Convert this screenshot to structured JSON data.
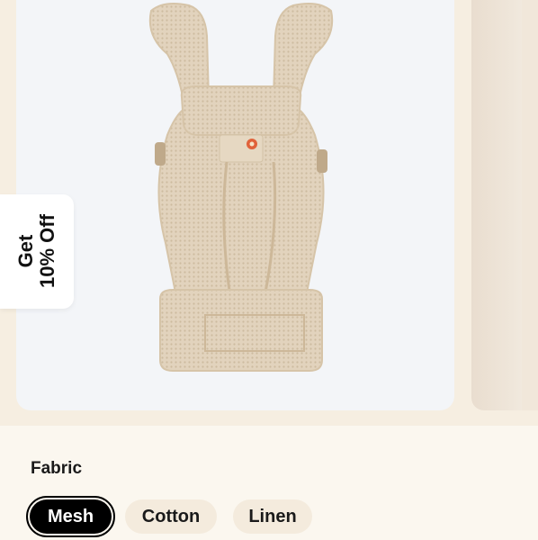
{
  "promo": {
    "line1": "Get",
    "line2": "10% Off"
  },
  "product": {
    "image_alt": "baby carrier product image"
  },
  "fabric": {
    "label": "Fabric",
    "options": [
      {
        "label": "Mesh",
        "selected": true
      },
      {
        "label": "Cotton",
        "selected": false
      },
      {
        "label": "Linen",
        "selected": false
      }
    ]
  },
  "colors": {
    "selected_chip": "#000000",
    "chip_bg": "#f4ebdd",
    "card_bg": "#f3f5f8"
  }
}
